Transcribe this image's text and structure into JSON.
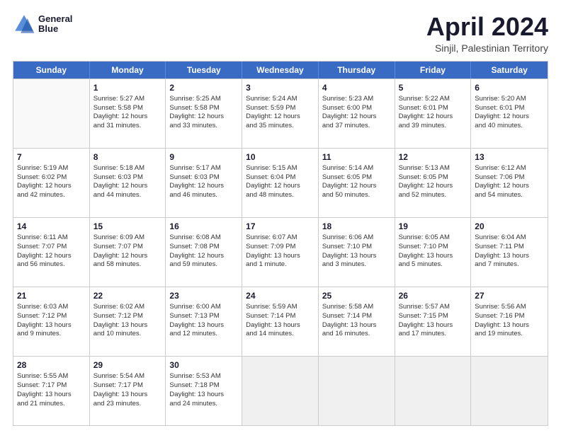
{
  "header": {
    "logo_line1": "General",
    "logo_line2": "Blue",
    "title": "April 2024",
    "subtitle": "Sinjil, Palestinian Territory"
  },
  "days": [
    "Sunday",
    "Monday",
    "Tuesday",
    "Wednesday",
    "Thursday",
    "Friday",
    "Saturday"
  ],
  "weeks": [
    [
      {
        "day": null,
        "content": []
      },
      {
        "day": "1",
        "content": [
          "Sunrise: 5:27 AM",
          "Sunset: 5:58 PM",
          "Daylight: 12 hours",
          "and 31 minutes."
        ]
      },
      {
        "day": "2",
        "content": [
          "Sunrise: 5:25 AM",
          "Sunset: 5:58 PM",
          "Daylight: 12 hours",
          "and 33 minutes."
        ]
      },
      {
        "day": "3",
        "content": [
          "Sunrise: 5:24 AM",
          "Sunset: 5:59 PM",
          "Daylight: 12 hours",
          "and 35 minutes."
        ]
      },
      {
        "day": "4",
        "content": [
          "Sunrise: 5:23 AM",
          "Sunset: 6:00 PM",
          "Daylight: 12 hours",
          "and 37 minutes."
        ]
      },
      {
        "day": "5",
        "content": [
          "Sunrise: 5:22 AM",
          "Sunset: 6:01 PM",
          "Daylight: 12 hours",
          "and 39 minutes."
        ]
      },
      {
        "day": "6",
        "content": [
          "Sunrise: 5:20 AM",
          "Sunset: 6:01 PM",
          "Daylight: 12 hours",
          "and 40 minutes."
        ]
      }
    ],
    [
      {
        "day": "7",
        "content": [
          "Sunrise: 5:19 AM",
          "Sunset: 6:02 PM",
          "Daylight: 12 hours",
          "and 42 minutes."
        ]
      },
      {
        "day": "8",
        "content": [
          "Sunrise: 5:18 AM",
          "Sunset: 6:03 PM",
          "Daylight: 12 hours",
          "and 44 minutes."
        ]
      },
      {
        "day": "9",
        "content": [
          "Sunrise: 5:17 AM",
          "Sunset: 6:03 PM",
          "Daylight: 12 hours",
          "and 46 minutes."
        ]
      },
      {
        "day": "10",
        "content": [
          "Sunrise: 5:15 AM",
          "Sunset: 6:04 PM",
          "Daylight: 12 hours",
          "and 48 minutes."
        ]
      },
      {
        "day": "11",
        "content": [
          "Sunrise: 5:14 AM",
          "Sunset: 6:05 PM",
          "Daylight: 12 hours",
          "and 50 minutes."
        ]
      },
      {
        "day": "12",
        "content": [
          "Sunrise: 5:13 AM",
          "Sunset: 6:05 PM",
          "Daylight: 12 hours",
          "and 52 minutes."
        ]
      },
      {
        "day": "13",
        "content": [
          "Sunrise: 6:12 AM",
          "Sunset: 7:06 PM",
          "Daylight: 12 hours",
          "and 54 minutes."
        ]
      }
    ],
    [
      {
        "day": "14",
        "content": [
          "Sunrise: 6:11 AM",
          "Sunset: 7:07 PM",
          "Daylight: 12 hours",
          "and 56 minutes."
        ]
      },
      {
        "day": "15",
        "content": [
          "Sunrise: 6:09 AM",
          "Sunset: 7:07 PM",
          "Daylight: 12 hours",
          "and 58 minutes."
        ]
      },
      {
        "day": "16",
        "content": [
          "Sunrise: 6:08 AM",
          "Sunset: 7:08 PM",
          "Daylight: 12 hours",
          "and 59 minutes."
        ]
      },
      {
        "day": "17",
        "content": [
          "Sunrise: 6:07 AM",
          "Sunset: 7:09 PM",
          "Daylight: 13 hours",
          "and 1 minute."
        ]
      },
      {
        "day": "18",
        "content": [
          "Sunrise: 6:06 AM",
          "Sunset: 7:10 PM",
          "Daylight: 13 hours",
          "and 3 minutes."
        ]
      },
      {
        "day": "19",
        "content": [
          "Sunrise: 6:05 AM",
          "Sunset: 7:10 PM",
          "Daylight: 13 hours",
          "and 5 minutes."
        ]
      },
      {
        "day": "20",
        "content": [
          "Sunrise: 6:04 AM",
          "Sunset: 7:11 PM",
          "Daylight: 13 hours",
          "and 7 minutes."
        ]
      }
    ],
    [
      {
        "day": "21",
        "content": [
          "Sunrise: 6:03 AM",
          "Sunset: 7:12 PM",
          "Daylight: 13 hours",
          "and 9 minutes."
        ]
      },
      {
        "day": "22",
        "content": [
          "Sunrise: 6:02 AM",
          "Sunset: 7:12 PM",
          "Daylight: 13 hours",
          "and 10 minutes."
        ]
      },
      {
        "day": "23",
        "content": [
          "Sunrise: 6:00 AM",
          "Sunset: 7:13 PM",
          "Daylight: 13 hours",
          "and 12 minutes."
        ]
      },
      {
        "day": "24",
        "content": [
          "Sunrise: 5:59 AM",
          "Sunset: 7:14 PM",
          "Daylight: 13 hours",
          "and 14 minutes."
        ]
      },
      {
        "day": "25",
        "content": [
          "Sunrise: 5:58 AM",
          "Sunset: 7:14 PM",
          "Daylight: 13 hours",
          "and 16 minutes."
        ]
      },
      {
        "day": "26",
        "content": [
          "Sunrise: 5:57 AM",
          "Sunset: 7:15 PM",
          "Daylight: 13 hours",
          "and 17 minutes."
        ]
      },
      {
        "day": "27",
        "content": [
          "Sunrise: 5:56 AM",
          "Sunset: 7:16 PM",
          "Daylight: 13 hours",
          "and 19 minutes."
        ]
      }
    ],
    [
      {
        "day": "28",
        "content": [
          "Sunrise: 5:55 AM",
          "Sunset: 7:17 PM",
          "Daylight: 13 hours",
          "and 21 minutes."
        ]
      },
      {
        "day": "29",
        "content": [
          "Sunrise: 5:54 AM",
          "Sunset: 7:17 PM",
          "Daylight: 13 hours",
          "and 23 minutes."
        ]
      },
      {
        "day": "30",
        "content": [
          "Sunrise: 5:53 AM",
          "Sunset: 7:18 PM",
          "Daylight: 13 hours",
          "and 24 minutes."
        ]
      },
      {
        "day": null,
        "content": []
      },
      {
        "day": null,
        "content": []
      },
      {
        "day": null,
        "content": []
      },
      {
        "day": null,
        "content": []
      }
    ]
  ]
}
